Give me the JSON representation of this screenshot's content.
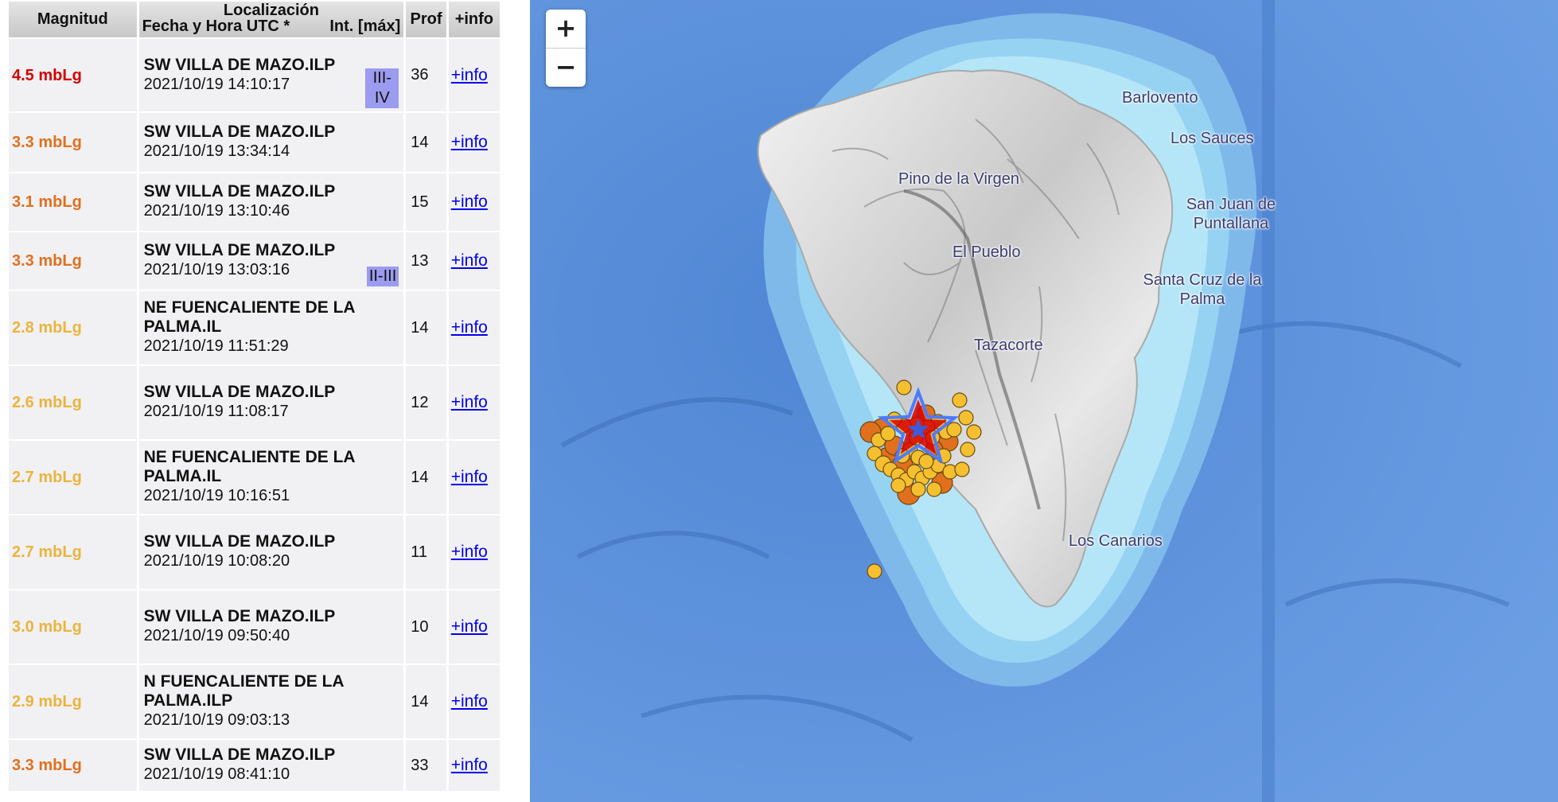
{
  "table": {
    "headers": {
      "magnitud": "Magnitud",
      "localizacion": "Localización",
      "fecha": "Fecha y Hora UTC *",
      "intensidad": "Int. [máx]",
      "prof": "Prof",
      "info": "+info"
    },
    "rows": [
      {
        "magnitude": "4.5 mbLg",
        "color": "#d40000",
        "location": "SW VILLA DE MAZO.ILP",
        "datetime": "2021/10/19 14:10:17",
        "intensity": "III-IV",
        "depth": "36",
        "info": "+info"
      },
      {
        "magnitude": "3.3 mbLg",
        "color": "#e0701e",
        "location": "SW VILLA DE MAZO.ILP",
        "datetime": "2021/10/19 13:34:14",
        "intensity": "",
        "depth": "14",
        "info": "+info"
      },
      {
        "magnitude": "3.1 mbLg",
        "color": "#e0701e",
        "location": "SW VILLA DE MAZO.ILP",
        "datetime": "2021/10/19 13:10:46",
        "intensity": "",
        "depth": "15",
        "info": "+info"
      },
      {
        "magnitude": "3.3 mbLg",
        "color": "#e0701e",
        "location": "SW VILLA DE MAZO.ILP",
        "datetime": "2021/10/19 13:03:16",
        "intensity": "II-III",
        "depth": "13",
        "info": "+info"
      },
      {
        "magnitude": "2.8 mbLg",
        "color": "#ebb43c",
        "location": "NE FUENCALIENTE DE LA PALMA.IL",
        "datetime": "2021/10/19 11:51:29",
        "intensity": "",
        "depth": "14",
        "info": "+info"
      },
      {
        "magnitude": "2.6 mbLg",
        "color": "#ebb43c",
        "location": "SW VILLA DE MAZO.ILP",
        "datetime": "2021/10/19 11:08:17",
        "intensity": "",
        "depth": "12",
        "info": "+info"
      },
      {
        "magnitude": "2.7 mbLg",
        "color": "#ebb43c",
        "location": "NE FUENCALIENTE DE LA PALMA.IL",
        "datetime": "2021/10/19 10:16:51",
        "intensity": "",
        "depth": "14",
        "info": "+info"
      },
      {
        "magnitude": "2.7 mbLg",
        "color": "#ebb43c",
        "location": "SW VILLA DE MAZO.ILP",
        "datetime": "2021/10/19 10:08:20",
        "intensity": "",
        "depth": "11",
        "info": "+info"
      },
      {
        "magnitude": "3.0 mbLg",
        "color": "#ebb43c",
        "location": "SW VILLA DE MAZO.ILP",
        "datetime": "2021/10/19 09:50:40",
        "intensity": "",
        "depth": "10",
        "info": "+info"
      },
      {
        "magnitude": "2.9 mbLg",
        "color": "#ebb43c",
        "location": "N FUENCALIENTE DE LA PALMA.ILP",
        "datetime": "2021/10/19 09:03:13",
        "intensity": "",
        "depth": "14",
        "info": "+info"
      },
      {
        "magnitude": "3.3 mbLg",
        "color": "#e0701e",
        "location": "SW VILLA DE MAZO.ILP",
        "datetime": "2021/10/19 08:41:10",
        "intensity": "",
        "depth": "33",
        "info": "+info"
      }
    ]
  },
  "map": {
    "zoom_in": "+",
    "zoom_out": "−",
    "places": {
      "barlovento": "Barlovento",
      "los_sauces": "Los Sauces",
      "pino": "Pino de la Virgen",
      "san_juan": "San Juan de Puntallana",
      "el_pueblo": "El Pueblo",
      "santa_cruz": "Santa Cruz de la Palma",
      "tazacorte": "Tazacorte",
      "los_canarios": "Los Canarios"
    },
    "epicenter_icon": "star-icon",
    "colors": {
      "ocean": "#5b8fd9",
      "strong": "#e0701e",
      "weak": "#f5c030",
      "epicenter": "#d40000"
    }
  }
}
